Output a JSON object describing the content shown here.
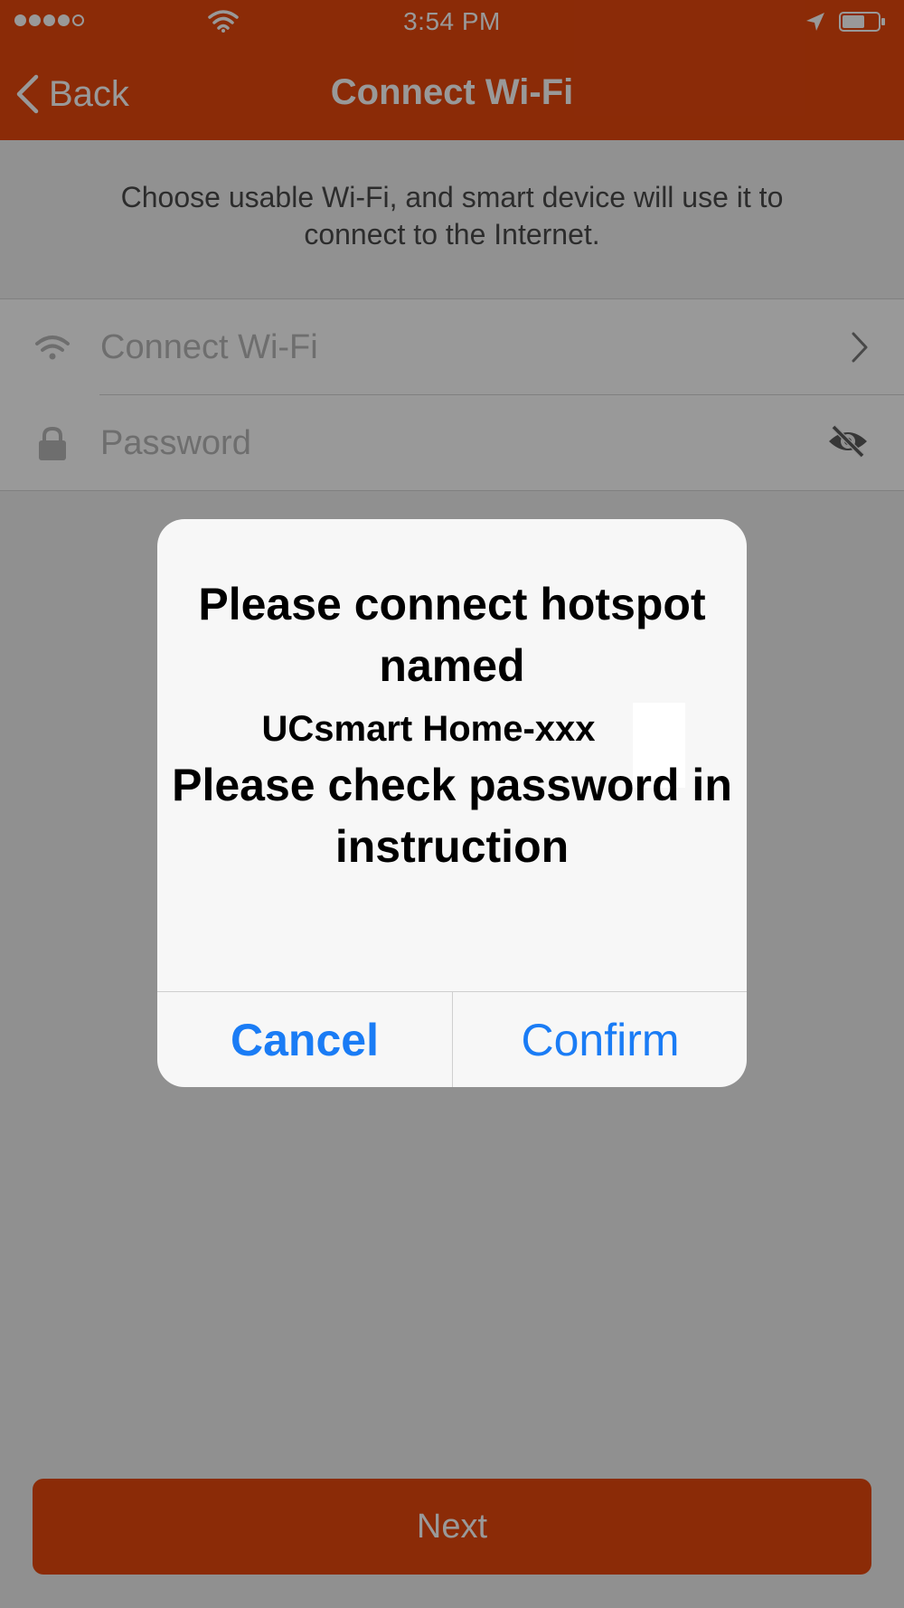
{
  "status_bar": {
    "time": "3:54 PM",
    "signal_icon": "signal-dots",
    "wifi_icon": "wifi-icon",
    "location_icon": "location-arrow-icon",
    "battery_icon": "battery-icon"
  },
  "nav": {
    "back_label": "Back",
    "title": "Connect Wi-Fi"
  },
  "intro": {
    "text": "Choose usable Wi-Fi, and smart device will use it to connect to the Internet."
  },
  "form": {
    "wifi_placeholder": "Connect Wi-Fi",
    "password_placeholder": "Password"
  },
  "next_button": {
    "label": "Next"
  },
  "dialog": {
    "line1": "Please connect hotspot named",
    "hotspot_name": "UCsmart Home-xxx",
    "line2": "Please check password in instruction",
    "cancel_label": "Cancel",
    "confirm_label": "Confirm"
  },
  "colors": {
    "brand": "#e8480d",
    "dialog_button": "#1a7cf5",
    "overlay": "rgba(0,0,0,0.4)"
  }
}
